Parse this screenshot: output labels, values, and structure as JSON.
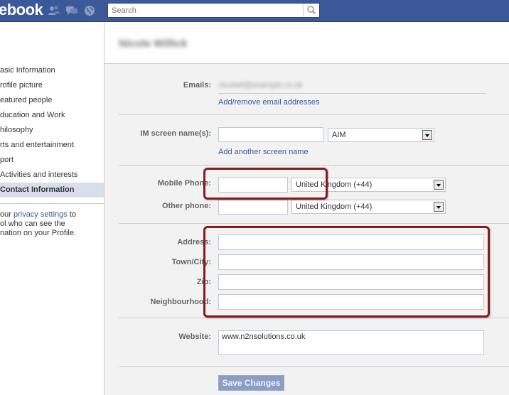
{
  "topbar": {
    "logo": "ebook",
    "search_placeholder": "Search",
    "icons": [
      "friends-icon",
      "messages-icon",
      "notifications-globe-icon",
      "search-magnifier-icon"
    ]
  },
  "sidebar": {
    "items": [
      {
        "label": "asic Information",
        "active": false
      },
      {
        "label": "rofile picture",
        "active": false
      },
      {
        "label": "eatured people",
        "active": false
      },
      {
        "label": "ducation and Work",
        "active": false
      },
      {
        "label": "hilosophy",
        "active": false
      },
      {
        "label": "rts and entertainment",
        "active": false
      },
      {
        "label": "port",
        "active": false
      },
      {
        "label": "Activities and interests",
        "active": false
      },
      {
        "label": "Contact Information",
        "active": true
      }
    ],
    "privacy_prefix": "our ",
    "privacy_link": "privacy settings",
    "privacy_suffix": " to",
    "privacy_line2": "ol who can see the",
    "privacy_line3": "nation on your Profile."
  },
  "profile": {
    "name": "Nicole Willick"
  },
  "form": {
    "emails_label": "Emails:",
    "emails_value": "nicolwil@example.co.uk",
    "emails_link": "Add/remove email addresses",
    "im_label": "IM screen name(s):",
    "im_value": "",
    "im_service": "AIM",
    "im_link": "Add another screen name",
    "mobile_label": "Mobile Phone:",
    "mobile_value": "",
    "mobile_country": "United Kingdom (+44)",
    "other_label": "Other phone:",
    "other_value": "",
    "other_country": "United Kingdom (+44)",
    "address_label": "Address:",
    "town_label": "Town/City:",
    "zip_label": "Zip:",
    "neighbourhood_label": "Neighbourhood:",
    "website_label": "Website:",
    "website_value": "www.n2nsolutions.co.uk",
    "save_label": "Save Changes"
  },
  "colors": {
    "brand": "#3b5998",
    "highlight": "#8b1a1a",
    "button": "#8d9ec3"
  }
}
